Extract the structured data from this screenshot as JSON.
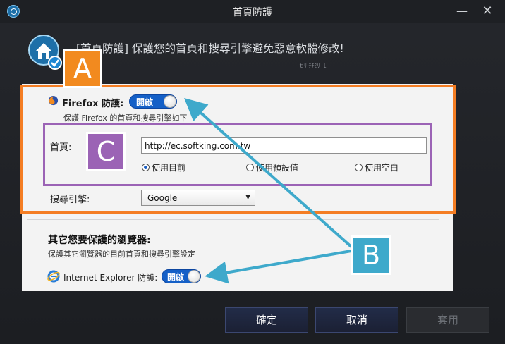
{
  "window": {
    "title": "首頁防護",
    "minimize_glyph": "—",
    "close_glyph": "✕"
  },
  "header": {
    "text": "[首頁防護] 保護您的首頁和搜尋引擎避免惡意軟體修改!",
    "tiny": "ｔﾘ ﾁﾁﾐﾘ ｌ"
  },
  "firefox": {
    "label": "Firefox 防護:",
    "toggle_label": "開啟",
    "note": "保護 Firefox 的首頁和搜尋引擎如下",
    "home_label": "首頁:",
    "home_value": "http://ec.softking.com.tw",
    "radios": [
      {
        "label": "使用目前",
        "checked": true
      },
      {
        "label": "使用預設值",
        "checked": false
      },
      {
        "label": "使用空白",
        "checked": false
      }
    ],
    "search_label": "搜尋引擎:",
    "search_value": "Google"
  },
  "other": {
    "title": "其它您要保護的瀏覽器:",
    "desc": "保護其它瀏覽器的目前首頁和搜尋引擎設定",
    "ie_label": "Internet Explorer 防護:",
    "ie_toggle_label": "開啟"
  },
  "badges": {
    "a": "A",
    "b": "B",
    "c": "C"
  },
  "footer": {
    "ok": "確定",
    "cancel": "取消",
    "apply": "套用"
  },
  "colors": {
    "accent_orange": "#f47d23",
    "accent_purple": "#9b63b5",
    "accent_cyan": "#3ea9cb",
    "toggle_blue": "#1560c7"
  }
}
